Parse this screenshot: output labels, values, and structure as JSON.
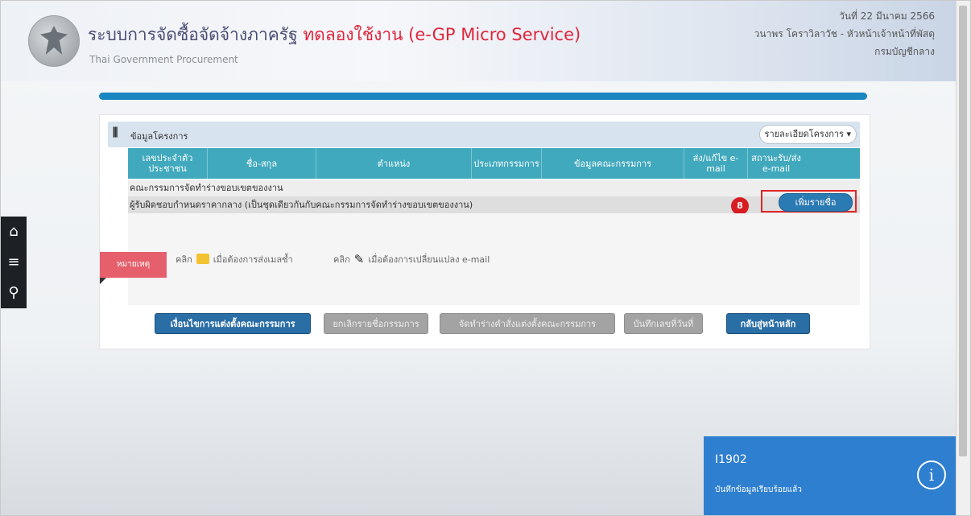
{
  "header": {
    "title_main": "ระบบการจัดซื้อจัดจ้างภาครัฐ",
    "title_trial": "ทดลองใช้งาน (e-GP Micro Service)",
    "subtitle": "Thai Government Procurement",
    "date": "วันที่ 22 มีนาคม 2566",
    "user": "วนาพร โคราวิลาวัช - หัวหน้าเจ้าหน้าที่พัสดุ",
    "department": "กรมบัญชีกลาง"
  },
  "sidebar": {
    "items": [
      {
        "icon": "home-icon"
      },
      {
        "icon": "menu-icon"
      },
      {
        "icon": "search-icon"
      }
    ]
  },
  "panel": {
    "title": "ข้อมูลโครงการ",
    "details_button": "รายละเอียดโครงการ",
    "columns": [
      "เลขประจำตัวประชาชน",
      "ชื่อ-สกุล",
      "ตำแหน่ง",
      "ประเภทกรรมการ",
      "ข้อมูลคณะกรรมการ",
      "ส่ง/แก้ไข e-mail",
      "สถานะรับ/ส่ง e-mail"
    ],
    "groups": [
      "คณะกรรมการจัดทำร่างขอบเขตของงาน",
      "ผู้รับผิดชอบกำหนดราคากลาง (เป็นชุดเดียวกันกับคณะกรรมการจัดทำร่างขอบเขตของงาน)"
    ],
    "add_button": "เพิ่มรายชื่อ",
    "step_marker": "8",
    "note_label": "หมายเหตุ",
    "note_click": "คลิก",
    "note_mail": "เมื่อต้องการส่งเมลซ้ำ",
    "note_edit": "เมื่อต้องการเปลี่ยนแปลง e-mail"
  },
  "actions": [
    {
      "label": "เงื่อนไขการแต่งตั้งคณะกรรมการ",
      "state": "enabled"
    },
    {
      "label": "ยกเลิกรายชื่อกรรมการ",
      "state": "disabled"
    },
    {
      "label": "จัดทำร่างคำสั่งแต่งตั้งคณะกรรมการ",
      "state": "disabled"
    },
    {
      "label": "บันทึกเลขที่วันที่",
      "state": "disabled"
    },
    {
      "label": "กลับสู่หน้าหลัก",
      "state": "enabled"
    }
  ],
  "toast": {
    "code": "I1902",
    "message": "บันทึกข้อมูลเรียบร้อยแล้ว"
  },
  "colors": {
    "header_blue_bar": "#1a86c1",
    "table_header": "#41a9bd",
    "primary_button": "#2a6ea6",
    "trial_red": "#e0263c",
    "toast": "#2f7fd0"
  }
}
